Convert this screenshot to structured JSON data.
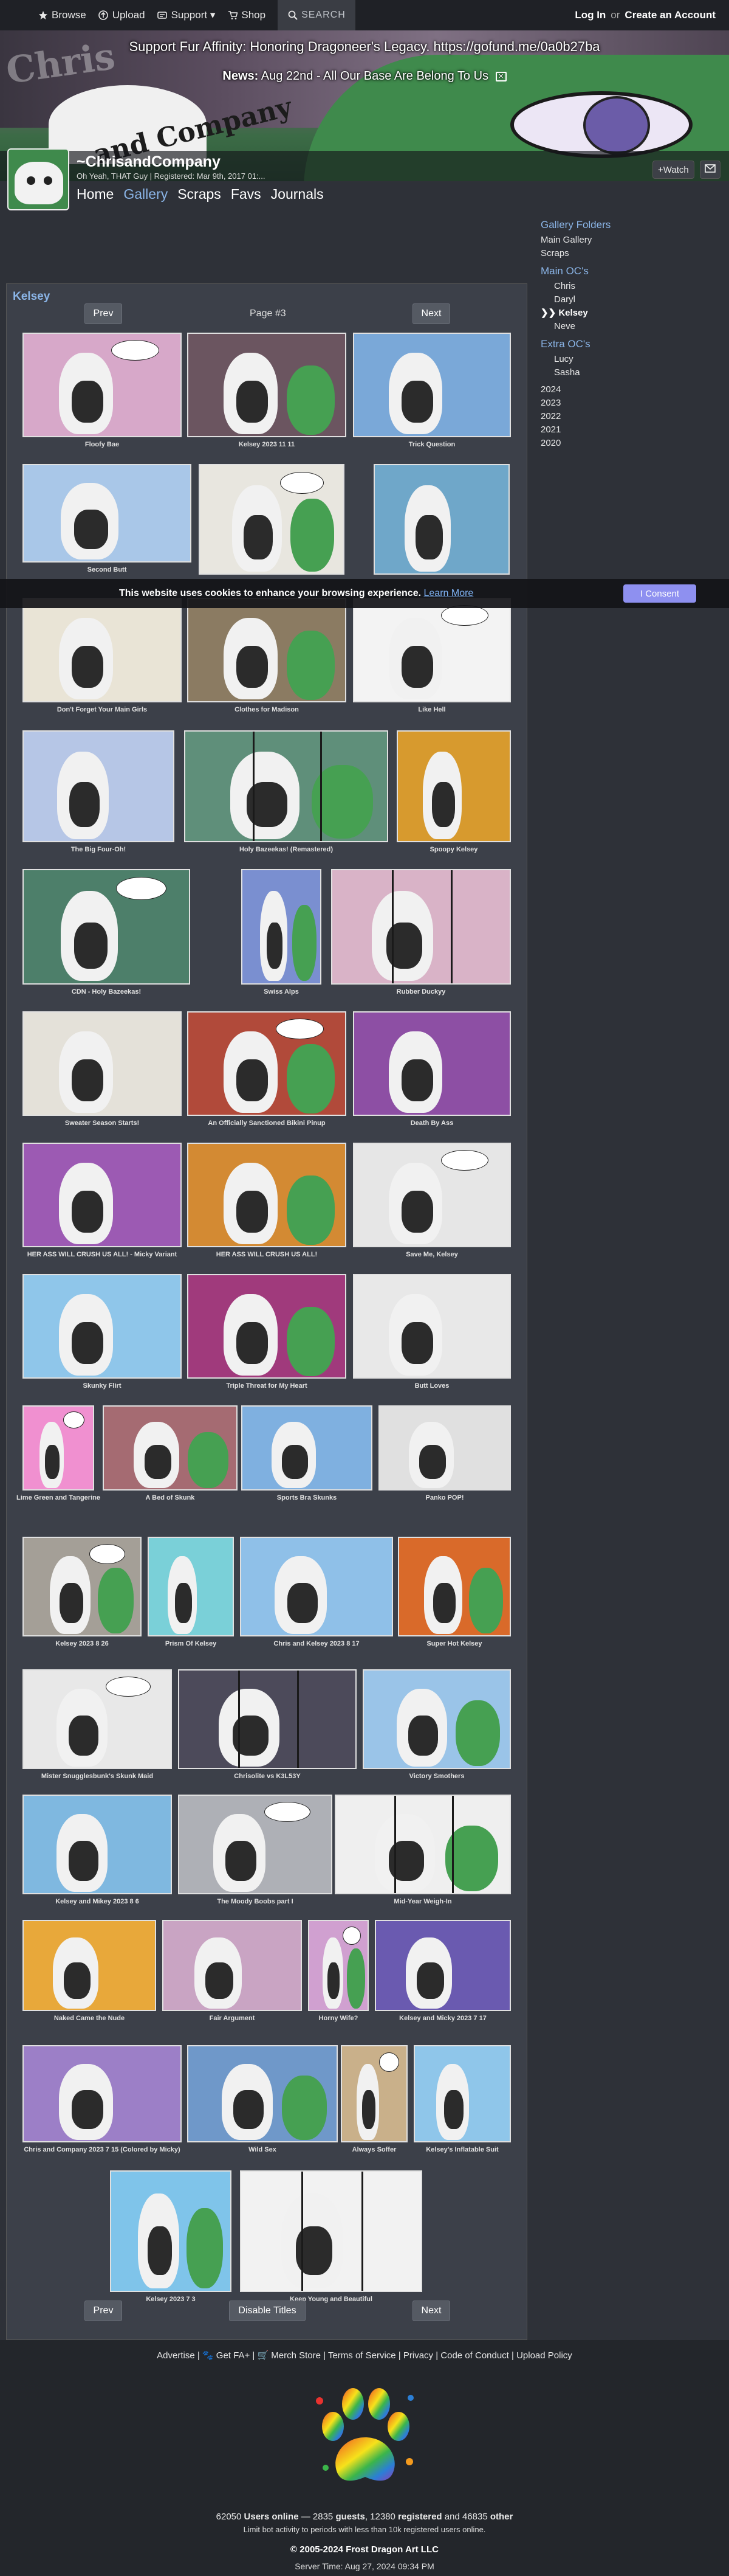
{
  "nav": {
    "browse": "Browse",
    "upload": "Upload",
    "support": "Support ▾",
    "shop": "Shop",
    "search": "SEARCH",
    "login": "Log In",
    "or": "or",
    "create": "Create an Account"
  },
  "banner": {
    "notice": "Support Fur Affinity: Honoring Dragoneer's Legacy. https://gofund.me/0a0b27ba",
    "news_label": "News:",
    "news_text": "Aug 22nd - All Our Base Are Belong To Us",
    "logo_line1": "Chris",
    "logo_line2": "and Company"
  },
  "user": {
    "name": "~ChrisandCompany",
    "subtitle": "Oh Yeah, THAT Guy | Registered: Mar 9th, 2017 01:...",
    "watch": "+Watch"
  },
  "tabs": [
    "Home",
    "Gallery",
    "Scraps",
    "Favs",
    "Journals"
  ],
  "folders": {
    "header1": "Gallery Folders",
    "main": [
      "Main Gallery",
      "Scraps"
    ],
    "header2": "Main OC's",
    "main_ocs": [
      "Chris",
      "Daryl",
      "Kelsey",
      "Neve"
    ],
    "current_marker": "❯❯",
    "header3": "Extra OC's",
    "extra_ocs": [
      "Lucy",
      "Sasha"
    ],
    "years": [
      "2024",
      "2023",
      "2022",
      "2021",
      "2020"
    ]
  },
  "gallery": {
    "title": "Kelsey",
    "prev": "Prev",
    "next": "Next",
    "page": "Page #3",
    "disable_titles": "Disable Titles"
  },
  "thumbs": [
    {
      "caption": "Floofy Bae",
      "bg": "#d7a8c9"
    },
    {
      "caption": "Kelsey 2023 11 11",
      "bg": "#6b5560"
    },
    {
      "caption": "Trick Question",
      "bg": "#7aa8d8"
    },
    {
      "caption": "Second Butt",
      "bg": "#a9c7e8"
    },
    {
      "caption": "",
      "bg": "#e8e6df"
    },
    {
      "caption": "",
      "bg": "#6fa7c9"
    },
    {
      "caption": "Don't Forget Your Main Girls",
      "bg": "#e9e4d6"
    },
    {
      "caption": "Clothes for Madison",
      "bg": "#8b7b62"
    },
    {
      "caption": "Like Hell",
      "bg": "#f3f3f3"
    },
    {
      "caption": "The Big Four-Oh!",
      "bg": "#b6c6e6"
    },
    {
      "caption": "Holy Bazeekas! (Remastered)",
      "bg": "#5f8f7a"
    },
    {
      "caption": "Spoopy Kelsey",
      "bg": "#d79a2e"
    },
    {
      "caption": "CDN - Holy Bazeekas!",
      "bg": "#4d7f6a"
    },
    {
      "caption": "Swiss Alps",
      "bg": "#7a8fd0"
    },
    {
      "caption": "Rubber Duckyy",
      "bg": "#d9b3c7"
    },
    {
      "caption": "Sweater Season Starts!",
      "bg": "#e4e1d9"
    },
    {
      "caption": "An Officially Sanctioned Bikini Pinup",
      "bg": "#b14a3a"
    },
    {
      "caption": "Death By Ass",
      "bg": "#8d4fa4"
    },
    {
      "caption": "HER ASS WILL CRUSH US ALL! - Micky Variant",
      "bg": "#9c5ab3"
    },
    {
      "caption": "HER ASS WILL CRUSH US ALL!",
      "bg": "#d38a33"
    },
    {
      "caption": "Save Me, Kelsey",
      "bg": "#e6e6e6"
    },
    {
      "caption": "Skunky Flirt",
      "bg": "#8fc6ea"
    },
    {
      "caption": "Triple Threat for My Heart",
      "bg": "#a03a7c"
    },
    {
      "caption": "Butt Loves",
      "bg": "#e8e8e8"
    },
    {
      "caption": "Lime Green and Tangerine",
      "bg": "#f090d0"
    },
    {
      "caption": "A Bed of Skunk",
      "bg": "#a56b72"
    },
    {
      "caption": "Sports Bra Skunks",
      "bg": "#7fb0e0"
    },
    {
      "caption": "Panko POP!",
      "bg": "#e0e0e0"
    },
    {
      "caption": "Kelsey 2023 8 26",
      "bg": "#a49f97"
    },
    {
      "caption": "Prism Of Kelsey",
      "bg": "#7ad0d8"
    },
    {
      "caption": "Chris and Kelsey 2023 8 17",
      "bg": "#8fc0e8"
    },
    {
      "caption": "Super Hot Kelsey",
      "bg": "#d96a2a"
    },
    {
      "caption": "Mister Snugglesbunk's Skunk Maid",
      "bg": "#e8e8e8"
    },
    {
      "caption": "Chrisolite vs K3L53Y",
      "bg": "#4c4a5a"
    },
    {
      "caption": "Victory Smothers",
      "bg": "#9ac4e8"
    },
    {
      "caption": "Kelsey and Mikey 2023 8 6",
      "bg": "#7fb8e0"
    },
    {
      "caption": "The Moody Boobs part I",
      "bg": "#aeb0b6"
    },
    {
      "caption": "Mid-Year Weigh-In",
      "bg": "#efefef"
    },
    {
      "caption": "Naked Came the Nude",
      "bg": "#e8a83a"
    },
    {
      "caption": "Fair Argument",
      "bg": "#c9a4c3"
    },
    {
      "caption": "Horny Wife?",
      "bg": "#d0a0d0"
    },
    {
      "caption": "Kelsey and Micky 2023 7 17",
      "bg": "#6a5ab0"
    },
    {
      "caption": "Chris and Company 2023 7 15 (Colored by Micky)",
      "bg": "#9c7fc7"
    },
    {
      "caption": "Wild Sex",
      "bg": "#6f98c9"
    },
    {
      "caption": "Always Soffer",
      "bg": "#c9b08a"
    },
    {
      "caption": "Kelsey's Inflatable Suit",
      "bg": "#8fc6ea"
    },
    {
      "caption": "Kelsey 2023 7 3",
      "bg": "#7fc4ea"
    },
    {
      "caption": "Keep Young and Beautiful",
      "bg": "#f2f2f2"
    }
  ],
  "cookie": {
    "message": "This website uses cookies to enhance your browsing experience.",
    "learn_more": "Learn More",
    "consent": "I Consent"
  },
  "footer": {
    "links": "Advertise | 🐾 Get FA+ | 🛒 Merch Store | Terms of Service | Privacy | Code of Conduct | Upload Policy",
    "stats_users": "62050",
    "stats_users_label": "Users online",
    "stats_guests": "2835",
    "stats_guests_label": "guests",
    "stats_registered": "12380",
    "stats_registered_label": "registered",
    "stats_other": "46835",
    "stats_other_label": "other",
    "limit": "Limit bot activity to periods with less than 10k registered users online.",
    "copyright": "© 2005-2024 Frost Dragon Art LLC",
    "server_time": "Server Time: Aug 27, 2024 09:34 PM"
  }
}
